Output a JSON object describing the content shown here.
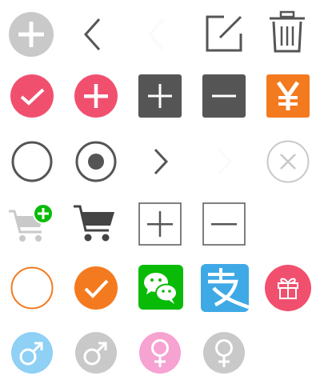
{
  "icon_sheet": {
    "rows": [
      [
        "plus-circle-gray-icon",
        "chevron-left-icon",
        "chevron-left-faint-icon",
        "edit-icon",
        "trash-icon"
      ],
      [
        "check-circle-red-icon",
        "plus-circle-red-icon",
        "plus-square-dark-icon",
        "minus-square-dark-icon",
        "yen-square-orange-icon"
      ],
      [
        "radio-unchecked-icon",
        "radio-checked-icon",
        "chevron-right-icon",
        "chevron-right-faint-icon",
        "close-circle-outline-icon"
      ],
      [
        "cart-add-icon",
        "cart-icon",
        "plus-square-outline-icon",
        "minus-square-outline-icon"
      ],
      [
        "circle-outline-orange-icon",
        "check-circle-orange-icon",
        "wechat-icon",
        "alipay-icon",
        "gift-circle-icon"
      ],
      [
        "male-blue-icon",
        "male-gray-icon",
        "female-pink-icon",
        "female-gray-icon"
      ]
    ]
  },
  "colors": {
    "gray_light": "#c9c9c9",
    "gray_stroke": "#555555",
    "red": "#f0506e",
    "dark_square": "#555555",
    "orange": "#f47a20",
    "wechat_green": "#09bb07",
    "alipay_blue": "#3fa9e6",
    "blue_light": "#8fd0f5",
    "pink_light": "#f6a3d2"
  }
}
